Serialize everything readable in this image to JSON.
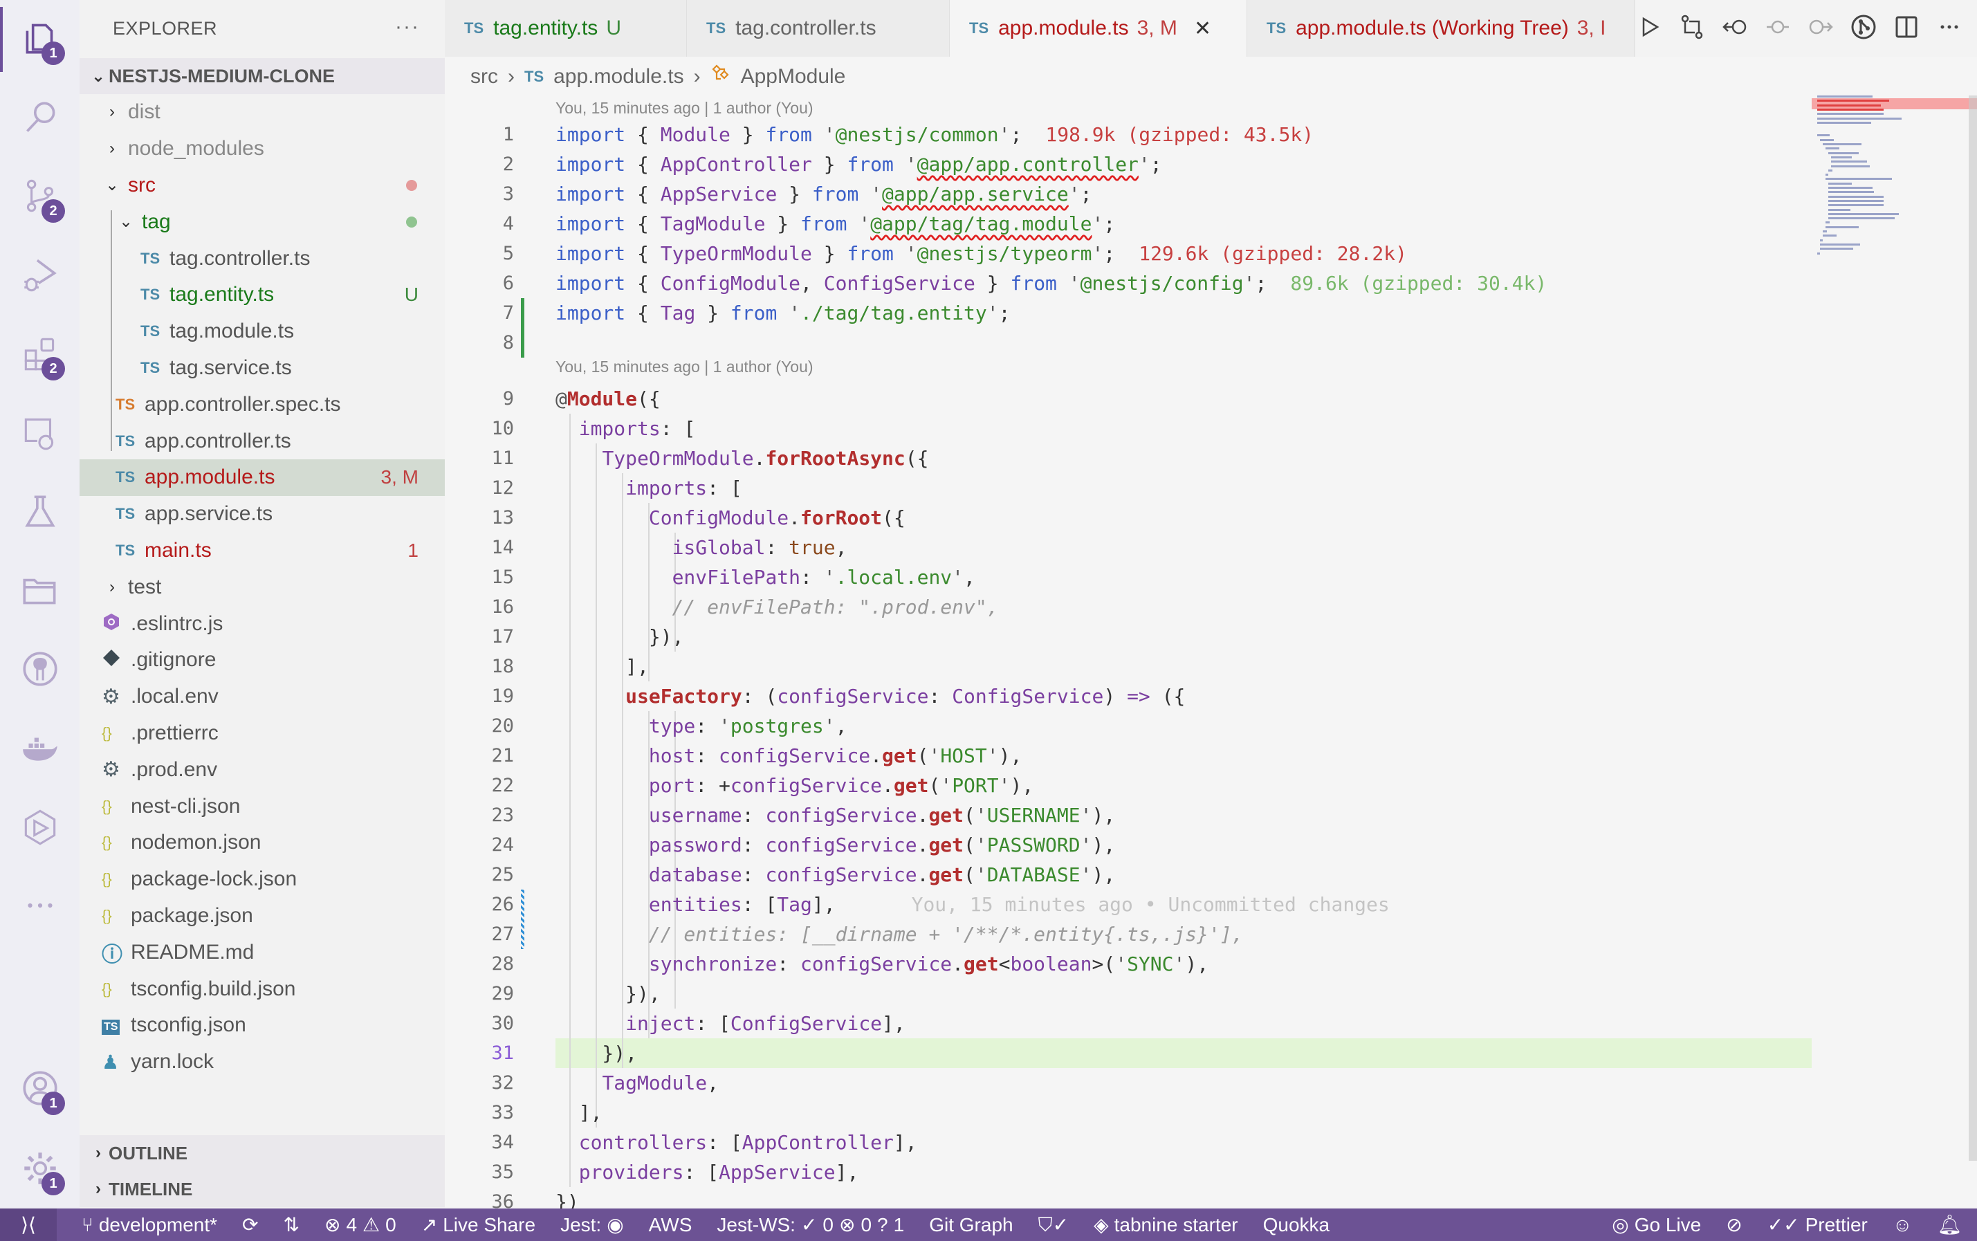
{
  "activity_bar": {
    "items": [
      {
        "name": "explorer",
        "icon": "files-icon",
        "badge": "1",
        "active": true
      },
      {
        "name": "search",
        "icon": "search-icon",
        "badge": null
      },
      {
        "name": "source-control",
        "icon": "source-control-icon",
        "badge": "2"
      },
      {
        "name": "run-debug",
        "icon": "run-debug-icon",
        "badge": null
      },
      {
        "name": "extensions",
        "icon": "extensions-icon",
        "badge": "2"
      },
      {
        "name": "remote-explorer",
        "icon": "remote-explorer-icon",
        "badge": null
      },
      {
        "name": "testing",
        "icon": "flask-icon",
        "badge": null
      },
      {
        "name": "project-manager",
        "icon": "folders-icon",
        "badge": null
      },
      {
        "name": "github",
        "icon": "github-icon",
        "badge": null
      },
      {
        "name": "docker",
        "icon": "docker-icon",
        "badge": null
      },
      {
        "name": "quokka",
        "icon": "play-hexagon-icon",
        "badge": null
      },
      {
        "name": "more",
        "icon": "ellipsis-icon",
        "badge": null
      }
    ],
    "bottom": [
      {
        "name": "accounts",
        "icon": "account-icon",
        "badge": "1"
      },
      {
        "name": "manage",
        "icon": "gear-icon",
        "badge": "1"
      }
    ]
  },
  "sidebar": {
    "title": "EXPLORER",
    "more": "···",
    "root": "NESTJS-MEDIUM-CLONE",
    "tree": [
      {
        "label": "dist",
        "type": "folder",
        "depth": 1,
        "expanded": false,
        "color": "#888888"
      },
      {
        "label": "node_modules",
        "type": "folder",
        "depth": 1,
        "expanded": false,
        "color": "#888888"
      },
      {
        "label": "src",
        "type": "folder",
        "depth": 1,
        "expanded": true,
        "color": "#b51a1a",
        "dot": "#e59a9a"
      },
      {
        "label": "tag",
        "type": "folder",
        "depth": 2,
        "expanded": true,
        "color": "#1a7a1a",
        "dot": "#90c490"
      },
      {
        "label": "tag.controller.ts",
        "type": "ts",
        "depth": 3,
        "color": "#555555"
      },
      {
        "label": "tag.entity.ts",
        "type": "ts",
        "depth": 3,
        "color": "#1a7a1a",
        "decoration": "U",
        "decoration_color": "#3c8a3c"
      },
      {
        "label": "tag.module.ts",
        "type": "ts",
        "depth": 3,
        "color": "#555555"
      },
      {
        "label": "tag.service.ts",
        "type": "ts",
        "depth": 3,
        "color": "#555555"
      },
      {
        "label": "app.controller.spec.ts",
        "type": "ts-spec",
        "depth": 2,
        "color": "#555555"
      },
      {
        "label": "app.controller.ts",
        "type": "ts",
        "depth": 2,
        "color": "#555555"
      },
      {
        "label": "app.module.ts",
        "type": "ts",
        "depth": 2,
        "color": "#b51a1a",
        "decoration": "3, M",
        "decoration_color": "#c04040",
        "selected": true
      },
      {
        "label": "app.service.ts",
        "type": "ts",
        "depth": 2,
        "color": "#555555"
      },
      {
        "label": "main.ts",
        "type": "ts",
        "depth": 2,
        "color": "#b51a1a",
        "decoration": "1",
        "decoration_color": "#c04040"
      },
      {
        "label": "test",
        "type": "folder",
        "depth": 1,
        "expanded": false,
        "color": "#555555"
      },
      {
        "label": ".eslintrc.js",
        "type": "eslint",
        "depth": 1,
        "color": "#555555"
      },
      {
        "label": ".gitignore",
        "type": "git",
        "depth": 1,
        "color": "#555555"
      },
      {
        "label": ".local.env",
        "type": "env",
        "depth": 1,
        "color": "#555555"
      },
      {
        "label": ".prettierrc",
        "type": "json",
        "depth": 1,
        "color": "#555555"
      },
      {
        "label": ".prod.env",
        "type": "env",
        "depth": 1,
        "color": "#555555"
      },
      {
        "label": "nest-cli.json",
        "type": "json",
        "depth": 1,
        "color": "#555555"
      },
      {
        "label": "nodemon.json",
        "type": "json",
        "depth": 1,
        "color": "#555555"
      },
      {
        "label": "package-lock.json",
        "type": "json",
        "depth": 1,
        "color": "#555555"
      },
      {
        "label": "package.json",
        "type": "json",
        "depth": 1,
        "color": "#555555"
      },
      {
        "label": "README.md",
        "type": "info",
        "depth": 1,
        "color": "#555555"
      },
      {
        "label": "tsconfig.build.json",
        "type": "json",
        "depth": 1,
        "color": "#555555"
      },
      {
        "label": "tsconfig.json",
        "type": "tsconfig",
        "depth": 1,
        "color": "#555555"
      },
      {
        "label": "yarn.lock",
        "type": "yarn",
        "depth": 1,
        "color": "#555555"
      }
    ],
    "sections": [
      "OUTLINE",
      "TIMELINE"
    ]
  },
  "tabs": [
    {
      "label": "tag.entity.ts",
      "badge": "U",
      "color": "#1a7a1a",
      "badge_color": "#3c8a3c",
      "active": false
    },
    {
      "label": "tag.controller.ts",
      "badge": "",
      "color": "#666666",
      "badge_color": "#666666",
      "active": false
    },
    {
      "label": "app.module.ts",
      "badge": "3, M",
      "color": "#b51a1a",
      "badge_color": "#c04040",
      "active": true,
      "close": "✕"
    },
    {
      "label": "app.module.ts (Working Tree)",
      "badge": "3, I",
      "color": "#b51a1a",
      "badge_color": "#c04040",
      "active": false
    }
  ],
  "tab_actions": [
    "run-icon",
    "compare-changes-icon",
    "previous-change-icon",
    "revert-icon",
    "next-change-icon",
    "git-lens-icon",
    "split-editor-icon",
    "more-actions-icon"
  ],
  "breadcrumb": {
    "items": [
      "src",
      "app.module.ts",
      "AppModule"
    ],
    "ts_badge": "TS"
  },
  "editor": {
    "codelens": [
      {
        "before_line": 1,
        "text": "You, 15 minutes ago | 1 author (You)"
      },
      {
        "before_line": 9,
        "text": "You, 15 minutes ago | 1 author (You)"
      }
    ],
    "current_line": 31,
    "import_costs": [
      {
        "line": 1,
        "text": "198.9k (gzipped: 43.5k)",
        "level": "red"
      },
      {
        "line": 5,
        "text": "129.6k (gzipped: 28.2k)",
        "level": "red"
      },
      {
        "line": 6,
        "text": "89.6k (gzipped: 30.4k)",
        "level": "green"
      }
    ],
    "inline_blame": {
      "line": 26,
      "text": "You, 15 minutes ago • Uncommitted changes"
    },
    "lines": [
      "import { Module } from '@nestjs/common';",
      "import { AppController } from '@app/app.controller';",
      "import { AppService } from '@app/app.service';",
      "import { TagModule } from '@app/tag/tag.module';",
      "import { TypeOrmModule } from '@nestjs/typeorm';",
      "import { ConfigModule, ConfigService } from '@nestjs/config';",
      "import { Tag } from './tag/tag.entity';",
      "",
      "@Module({",
      "  imports: [",
      "    TypeOrmModule.forRootAsync({",
      "      imports: [",
      "        ConfigModule.forRoot({",
      "          isGlobal: true,",
      "          envFilePath: '.local.env',",
      "          // envFilePath: \".prod.env\",",
      "        }),",
      "      ],",
      "      useFactory: (configService: ConfigService) => ({",
      "        type: 'postgres',",
      "        host: configService.get('HOST'),",
      "        port: +configService.get('PORT'),",
      "        username: configService.get('USERNAME'),",
      "        password: configService.get('PASSWORD'),",
      "        database: configService.get('DATABASE'),",
      "        entities: [Tag],",
      "        // entities: [__dirname + '/**/*.entity{.ts,.js}'],",
      "        synchronize: configService.get<boolean>('SYNC'),",
      "      }),",
      "      inject: [ConfigService],",
      "    }),",
      "    TagModule,",
      "  ],",
      "  controllers: [AppController],",
      "  providers: [AppService],",
      "})"
    ]
  },
  "status_bar": {
    "left": [
      {
        "name": "remote",
        "icon": "remote-icon",
        "text": ""
      },
      {
        "name": "branch",
        "icon": "git-branch-icon",
        "text": "development*"
      },
      {
        "name": "sync",
        "icon": "sync-icon",
        "text": ""
      },
      {
        "name": "git-compare",
        "icon": "git-compare-icon",
        "text": ""
      },
      {
        "name": "problems",
        "icon": "error-icon",
        "text": "4",
        "warnings": "0"
      },
      {
        "name": "live-share",
        "icon": "live-share-icon",
        "text": "Live Share"
      },
      {
        "name": "jest",
        "icon": "eye-icon",
        "text": "Jest:"
      },
      {
        "name": "aws",
        "icon": null,
        "text": "AWS"
      },
      {
        "name": "jest-ws",
        "icon": null,
        "text": "Jest-WS:",
        "passed": "0",
        "failed": "0",
        "unknown": "1"
      },
      {
        "name": "git-graph",
        "icon": null,
        "text": "Git Graph"
      },
      {
        "name": "security",
        "icon": "shield-check-icon",
        "text": ""
      },
      {
        "name": "tabnine",
        "icon": "tabnine-icon",
        "text": "tabnine starter"
      },
      {
        "name": "quokka",
        "icon": null,
        "text": "Quokka"
      }
    ],
    "right": [
      {
        "name": "go-live",
        "icon": "broadcast-icon",
        "text": "Go Live"
      },
      {
        "name": "copilot",
        "icon": "copilot-disabled-icon",
        "text": ""
      },
      {
        "name": "prettier",
        "icon": "double-check-icon",
        "text": "Prettier"
      },
      {
        "name": "feedback",
        "icon": "person-feedback-icon",
        "text": ""
      },
      {
        "name": "notifications",
        "icon": "bell-icon",
        "text": ""
      }
    ]
  }
}
